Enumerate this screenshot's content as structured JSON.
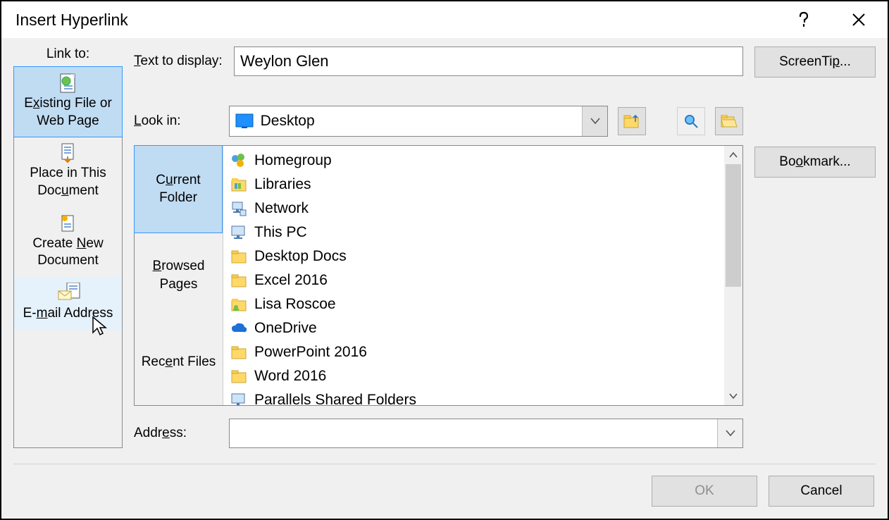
{
  "dialog": {
    "title": "Insert Hyperlink"
  },
  "link_to": {
    "label": "Link to:",
    "tabs": [
      {
        "line1_pre": "E",
        "line1_u": "x",
        "line1_post": "isting File or",
        "line2": "Web Page"
      },
      {
        "line1": "Place in This",
        "line2_pre": "Doc",
        "line2_u": "u",
        "line2_post": "ment"
      },
      {
        "line1_pre": "Create ",
        "line1_u": "N",
        "line1_post": "ew",
        "line2": "Document"
      },
      {
        "line1_pre": "E-",
        "line1_u": "m",
        "line1_post": "ail Address"
      }
    ]
  },
  "text_to_display": {
    "label_pre": "",
    "label_u": "T",
    "label_post": "ext to display:",
    "value": "Weylon Glen"
  },
  "screentip": {
    "label_pre": "ScreenTi",
    "label_u": "p",
    "label_post": "..."
  },
  "look_in": {
    "label_pre": "",
    "label_u": "L",
    "label_post": "ook in:",
    "value": "Desktop"
  },
  "browse_tabs": {
    "current_pre": "C",
    "current_u": "u",
    "current_post": "rrent",
    "current_line2": "Folder",
    "browsed_u": "B",
    "browsed_post": "rowsed",
    "browsed_line2": "Pages",
    "recent_pre": "Rec",
    "recent_u": "e",
    "recent_post": "nt Files"
  },
  "files": [
    {
      "icon": "homegroup",
      "name": "Homegroup"
    },
    {
      "icon": "libraries",
      "name": "Libraries"
    },
    {
      "icon": "network",
      "name": "Network"
    },
    {
      "icon": "pc",
      "name": "This PC"
    },
    {
      "icon": "folder",
      "name": "Desktop Docs"
    },
    {
      "icon": "folder",
      "name": "Excel 2016"
    },
    {
      "icon": "userfolder",
      "name": "Lisa Roscoe"
    },
    {
      "icon": "onedrive",
      "name": "OneDrive"
    },
    {
      "icon": "folder",
      "name": "PowerPoint 2016"
    },
    {
      "icon": "folder",
      "name": "Word 2016"
    },
    {
      "icon": "pc",
      "name": "Parallels Shared Folders"
    }
  ],
  "address": {
    "label_pre": "Addr",
    "label_u": "e",
    "label_post": "ss:",
    "value": ""
  },
  "bookmark": {
    "label_pre": "Bo",
    "label_u": "o",
    "label_post": "kmark..."
  },
  "footer": {
    "ok": "OK",
    "cancel": "Cancel"
  }
}
